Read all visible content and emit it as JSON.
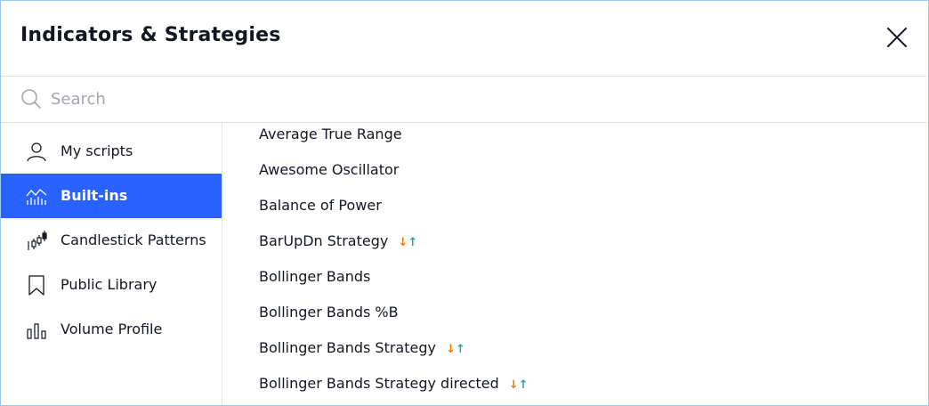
{
  "dialog": {
    "title": "Indicators & Strategies"
  },
  "search": {
    "placeholder": "Search",
    "value": ""
  },
  "sidebar": {
    "items": [
      {
        "label": "My scripts",
        "icon": "person-icon",
        "active": false
      },
      {
        "label": "Built-ins",
        "icon": "chart-line-icon",
        "active": true
      },
      {
        "label": "Candlestick Patterns",
        "icon": "candlestick-icon",
        "active": false
      },
      {
        "label": "Public Library",
        "icon": "bookmark-icon",
        "active": false
      },
      {
        "label": "Volume Profile",
        "icon": "volume-bars-icon",
        "active": false
      }
    ]
  },
  "list": {
    "items": [
      {
        "label": "Average True Range",
        "strategy": false
      },
      {
        "label": "Awesome Oscillator",
        "strategy": false
      },
      {
        "label": "Balance of Power",
        "strategy": false
      },
      {
        "label": "BarUpDn Strategy",
        "strategy": true
      },
      {
        "label": "Bollinger Bands",
        "strategy": false
      },
      {
        "label": "Bollinger Bands %B",
        "strategy": false
      },
      {
        "label": "Bollinger Bands Strategy",
        "strategy": true
      },
      {
        "label": "Bollinger Bands Strategy directed",
        "strategy": true
      }
    ],
    "strategy_arrows": {
      "down": "↓",
      "up": "↑"
    }
  },
  "colors": {
    "accent": "#2962ff",
    "border": "#9cc8f5",
    "strategy_down": "#f57c00",
    "strategy_up": "#26a69a"
  }
}
